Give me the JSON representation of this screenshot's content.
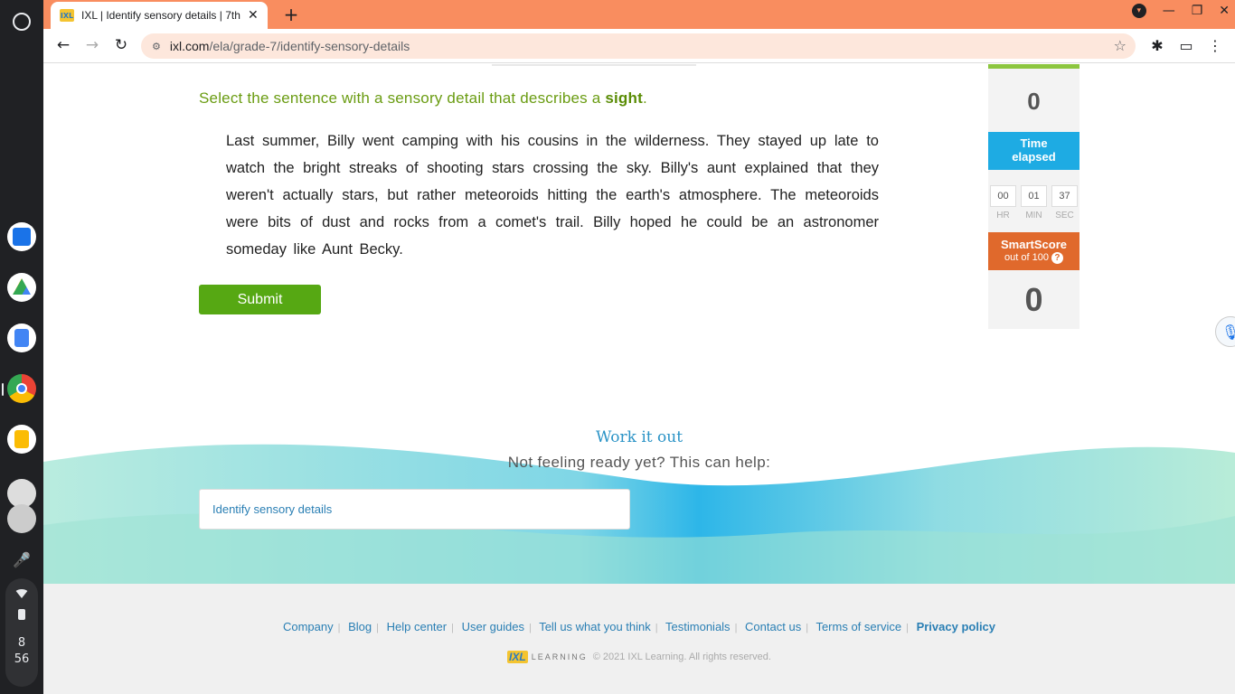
{
  "browser": {
    "tab_title": "IXL | Identify sensory details | 7th",
    "url_host": "ixl.com",
    "url_path": "/ela/grade-7/identify-sensory-details"
  },
  "question": {
    "prompt_prefix": "Select the sentence with a sensory detail that describes a ",
    "prompt_keyword": "sight",
    "prompt_suffix": ".",
    "sentences": [
      "Last summer, Billy went camping with his cousins in the wilderness.",
      "They stayed up late to watch the bright streaks of shooting stars crossing the sky.",
      "Billy's aunt explained that they weren't actually stars, but rather meteoroids hitting the earth's atmosphere.",
      "The meteoroids were bits of dust and rocks from a comet's trail.",
      "Billy hoped he could be an astronomer someday like Aunt Becky."
    ],
    "submit_label": "Submit"
  },
  "stats": {
    "questions_answered": "0",
    "time_label_1": "Time",
    "time_label_2": "elapsed",
    "hr": "00",
    "min": "01",
    "sec": "37",
    "hr_label": "HR",
    "min_label": "MIN",
    "sec_label": "SEC",
    "smartscore_label": "SmartScore",
    "smartscore_sub": "out of 100",
    "smartscore_help": "?",
    "smartscore_value": "0"
  },
  "work_it_out": {
    "title": "Work it out",
    "subtitle": "Not feeling ready yet? This can help:",
    "help_link": "Identify sensory details"
  },
  "footer": {
    "links": [
      "Company",
      "Blog",
      "Help center",
      "User guides",
      "Tell us what you think",
      "Testimonials",
      "Contact us",
      "Terms of service",
      "Privacy policy"
    ],
    "logo_mark": "IXL",
    "logo_word": "LEARNING",
    "copyright": "© 2021 IXL Learning. All rights reserved."
  },
  "system": {
    "clock_hour": "8",
    "clock_min": "56"
  },
  "colors": {
    "tabbar": "#f98d5f",
    "prompt_green": "#6a9c12",
    "submit_green": "#56a813",
    "time_blue": "#1eabe3",
    "smartscore_orange": "#e0692c",
    "link_blue": "#2a7fb4"
  }
}
